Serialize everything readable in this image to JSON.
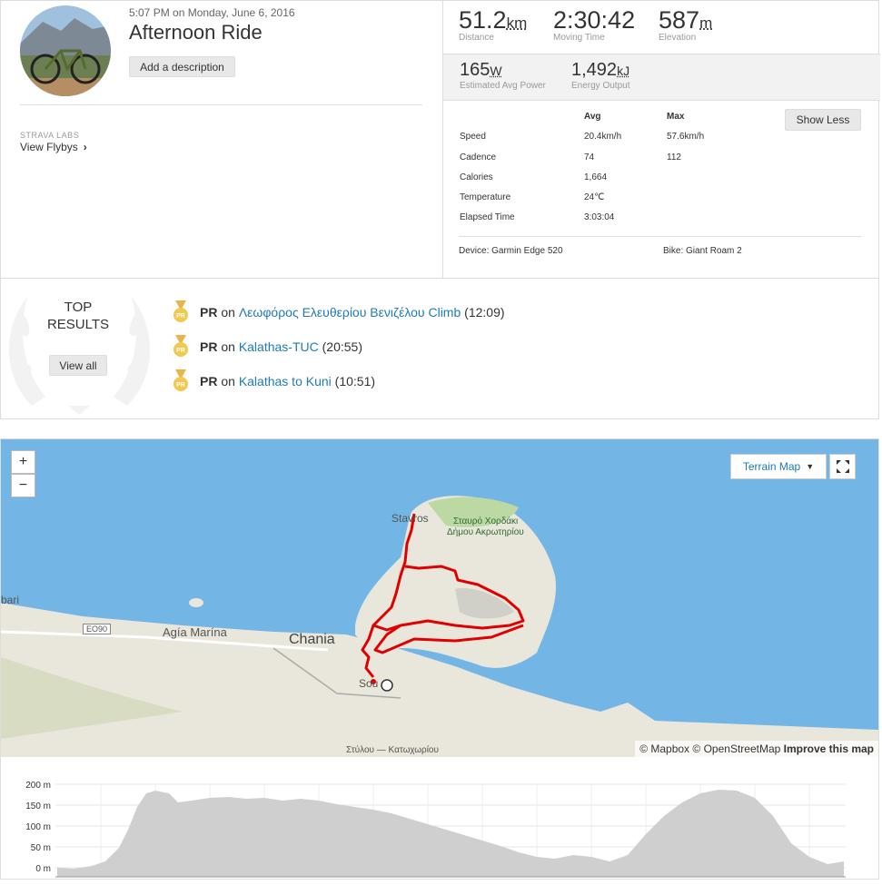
{
  "activity": {
    "date": "5:07 PM on Monday, June 6, 2016",
    "title": "Afternoon Ride",
    "add_description": "Add a description",
    "labs_label": "STRAVA LABS",
    "flybys": "View Flybys"
  },
  "primary_stats": [
    {
      "value": "51.2",
      "unit": "km",
      "label": "Distance"
    },
    {
      "value": "2:30:42",
      "unit": "",
      "label": "Moving Time"
    },
    {
      "value": "587",
      "unit": "m",
      "label": "Elevation"
    }
  ],
  "secondary_stats": [
    {
      "value": "165",
      "unit": "W",
      "label": "Estimated Avg Power"
    },
    {
      "value": "1,492",
      "unit": "kJ",
      "label": "Energy Output"
    }
  ],
  "more_stats": {
    "avg_header": "Avg",
    "max_header": "Max",
    "show_less": "Show Less",
    "rows": [
      {
        "label": "Speed",
        "avg": "20.4km/h",
        "max": "57.6km/h"
      },
      {
        "label": "Cadence",
        "avg": "74",
        "max": "112"
      },
      {
        "label": "Calories",
        "avg": "1,664",
        "max": ""
      },
      {
        "label": "Temperature",
        "avg": "24℃",
        "max": ""
      },
      {
        "label": "Elapsed Time",
        "avg": "3:03:04",
        "max": ""
      }
    ],
    "device": "Device: Garmin Edge 520",
    "bike": "Bike: Giant Roam 2"
  },
  "top_results": {
    "title_line1": "TOP",
    "title_line2": "RESULTS",
    "view_all": "View all",
    "items": [
      {
        "badge": "PR",
        "on": "on",
        "segment": "Λεωφόρος Ελευθερίου Βενιζέλου Climb",
        "time": "(12:09)"
      },
      {
        "badge": "PR",
        "on": "on",
        "segment": "Kalathas-TUC",
        "time": "(20:55)"
      },
      {
        "badge": "PR",
        "on": "on",
        "segment": "Kalathas to Kuni",
        "time": "(10:51)"
      }
    ]
  },
  "map": {
    "zoom_in": "+",
    "zoom_out": "−",
    "map_type": "Terrain Map",
    "attribution_mapbox": "© Mapbox",
    "attribution_osm": "© OpenStreetMap",
    "attribution_improve": "Improve this map",
    "places": [
      "Stavros",
      "Σταυρό Χορδάκι",
      "Δήμου Ακρωτηρίου",
      "Chania",
      "Agía Marína",
      "EO90",
      "bari",
      "Sou",
      "Στύλου — Κατωχωρίου"
    ]
  },
  "elevation": {
    "y_ticks": [
      "200 m",
      "150 m",
      "100 m",
      "50 m",
      "0 m"
    ]
  },
  "colors": {
    "route": "#e00000",
    "link": "#1e7bb8",
    "sea": "#73b6e6",
    "land": "#e9e6dc",
    "profile": "#cfcfcf"
  }
}
